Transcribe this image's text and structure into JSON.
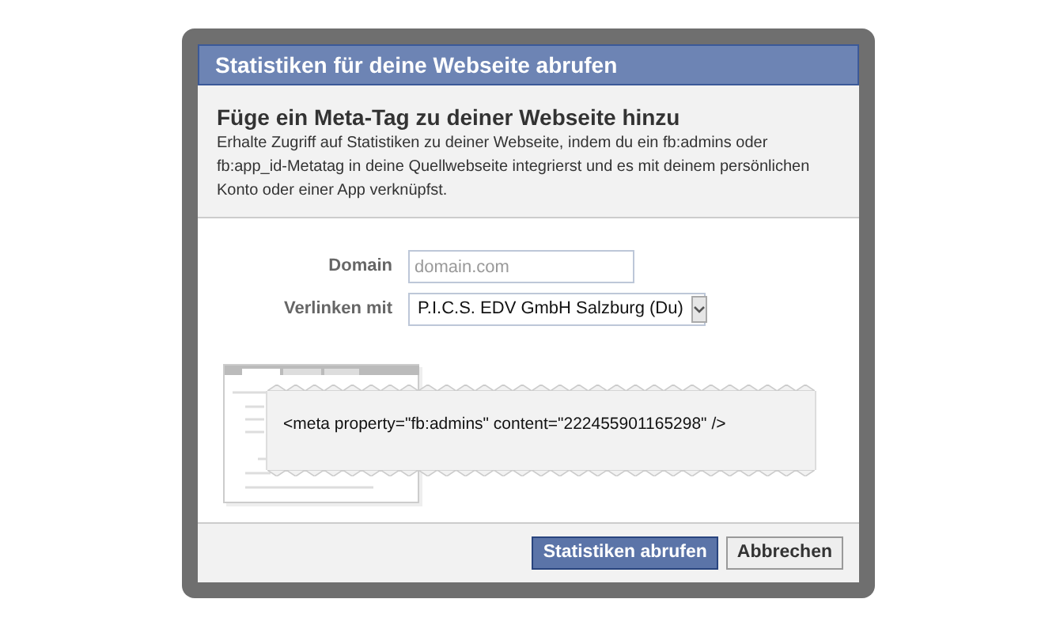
{
  "dialog": {
    "title": "Statistiken für deine Webseite abrufen",
    "heading": "Füge ein Meta-Tag zu deiner Webseite hinzu",
    "description": "Erhalte Zugriff auf Statistiken zu deiner Webseite, indem du ein fb:admins oder fb:app_id-Metatag in deine Quellwebseite integrierst und es mit deinem persönlichen Konto oder einer App verknüpfst.",
    "fields": [
      {
        "kind": "text",
        "label": "Domain",
        "placeholder": "domain.com"
      },
      {
        "kind": "select",
        "label": "Verlinken mit",
        "value": "P.I.C.S. EDV GmbH Salzburg (Du)"
      }
    ],
    "code": "<meta property=\"fb:admins\" content=\"222455901165298\" />",
    "buttons": [
      {
        "label": "Statistiken abrufen",
        "primary": true
      },
      {
        "label": "Abbrechen",
        "primary": false
      }
    ]
  }
}
